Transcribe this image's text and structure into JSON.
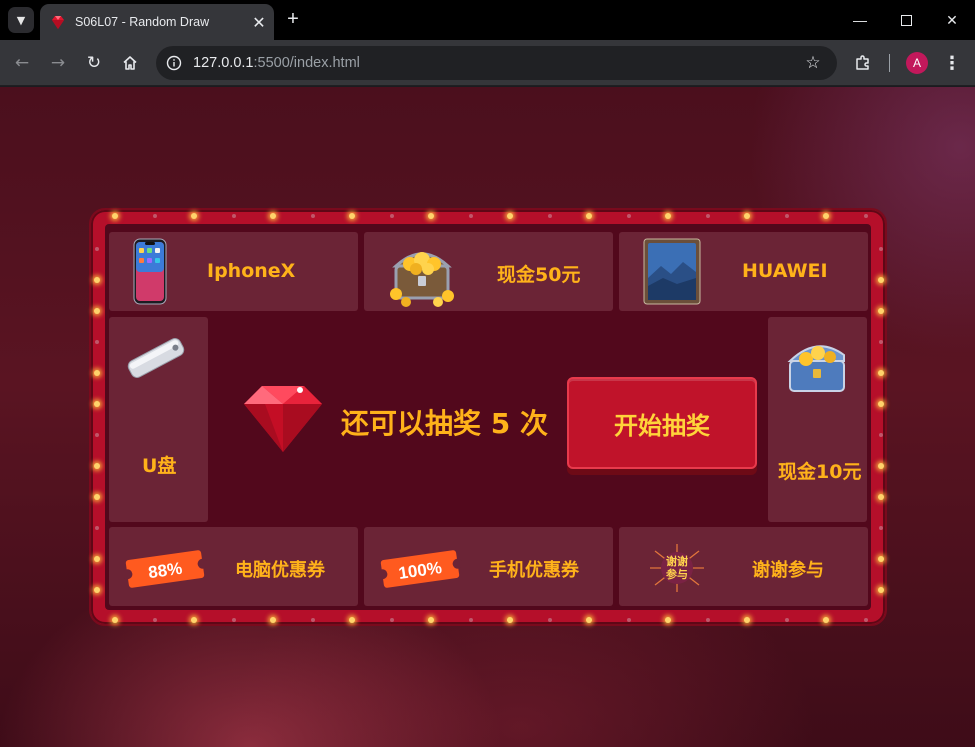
{
  "browser": {
    "tab_title": "S06L07 - Random Draw",
    "url_host": "127.0.0.1",
    "url_rest": ":5500/index.html",
    "profile_initial": "A"
  },
  "lottery": {
    "prizes": {
      "iphone": "IphoneX",
      "cash50": "现金50元",
      "huawei": "HUAWEI",
      "usb": "U盘",
      "cash10": "现金10元",
      "pc_coupon": "电脑优惠券",
      "phone_coupon": "手机优惠券",
      "thanks": "谢谢参与"
    },
    "coupons": {
      "pc_percent": "88%",
      "phone_percent": "100%",
      "thanks_badge_line1": "谢谢",
      "thanks_badge_line2": "参与"
    },
    "remaining_text": "还可以抽奖 5 次",
    "start_button": "开始抽奖"
  },
  "colors": {
    "accent_gold": "#ffb21a",
    "button_red": "#c0132a",
    "frame_red": "#b50f2a"
  }
}
